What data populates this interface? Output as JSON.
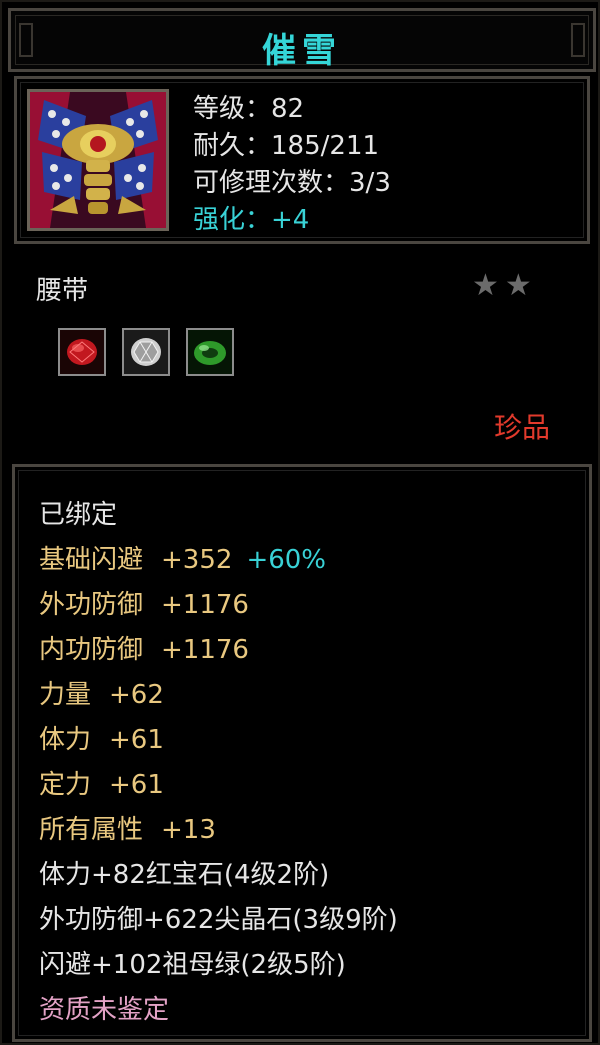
{
  "title": "催雪",
  "item": {
    "icon": "belt-icon",
    "level_label": "等级：",
    "level": "82",
    "durability_label": "耐久：",
    "durability": "185/211",
    "repair_label": "可修理次数：",
    "repair": "3/3",
    "enhance_label": "强化：",
    "enhance": "+4"
  },
  "type": "腰带",
  "stars": {
    "filled": 2,
    "color": "#6b6b6b"
  },
  "sockets": [
    {
      "icon": "ruby-gem-icon",
      "color": "#c2181f"
    },
    {
      "icon": "spinel-gem-icon",
      "color": "#d8d8d8"
    },
    {
      "icon": "emerald-gem-icon",
      "color": "#2e9a2a"
    }
  ],
  "rarity": "珍品",
  "attributes": {
    "bound": "已绑定",
    "dodge": {
      "label": "基础闪避",
      "value": "+352",
      "bonus": "+60%"
    },
    "rows": [
      {
        "label": "外功防御",
        "value": "+1176"
      },
      {
        "label": "内功防御",
        "value": "+1176"
      },
      {
        "label": "力量",
        "value": "+62"
      },
      {
        "label": "体力",
        "value": "+61"
      },
      {
        "label": "定力",
        "value": "+61"
      },
      {
        "label": "所有属性",
        "value": "+13"
      }
    ],
    "gems": [
      "体力+82红宝石(4级2阶)",
      "外功防御+622尖晶石(3级9阶)",
      "闪避+102祖母绿(2级5阶)"
    ],
    "quality": "资质未鉴定"
  },
  "colors": {
    "title": "#35d6d8",
    "stat": "#e6e6e6",
    "enhance": "#39d2d6",
    "attribute": "#e9c880",
    "rarity": "#e23a2c",
    "quality": "#e3a2c6"
  }
}
